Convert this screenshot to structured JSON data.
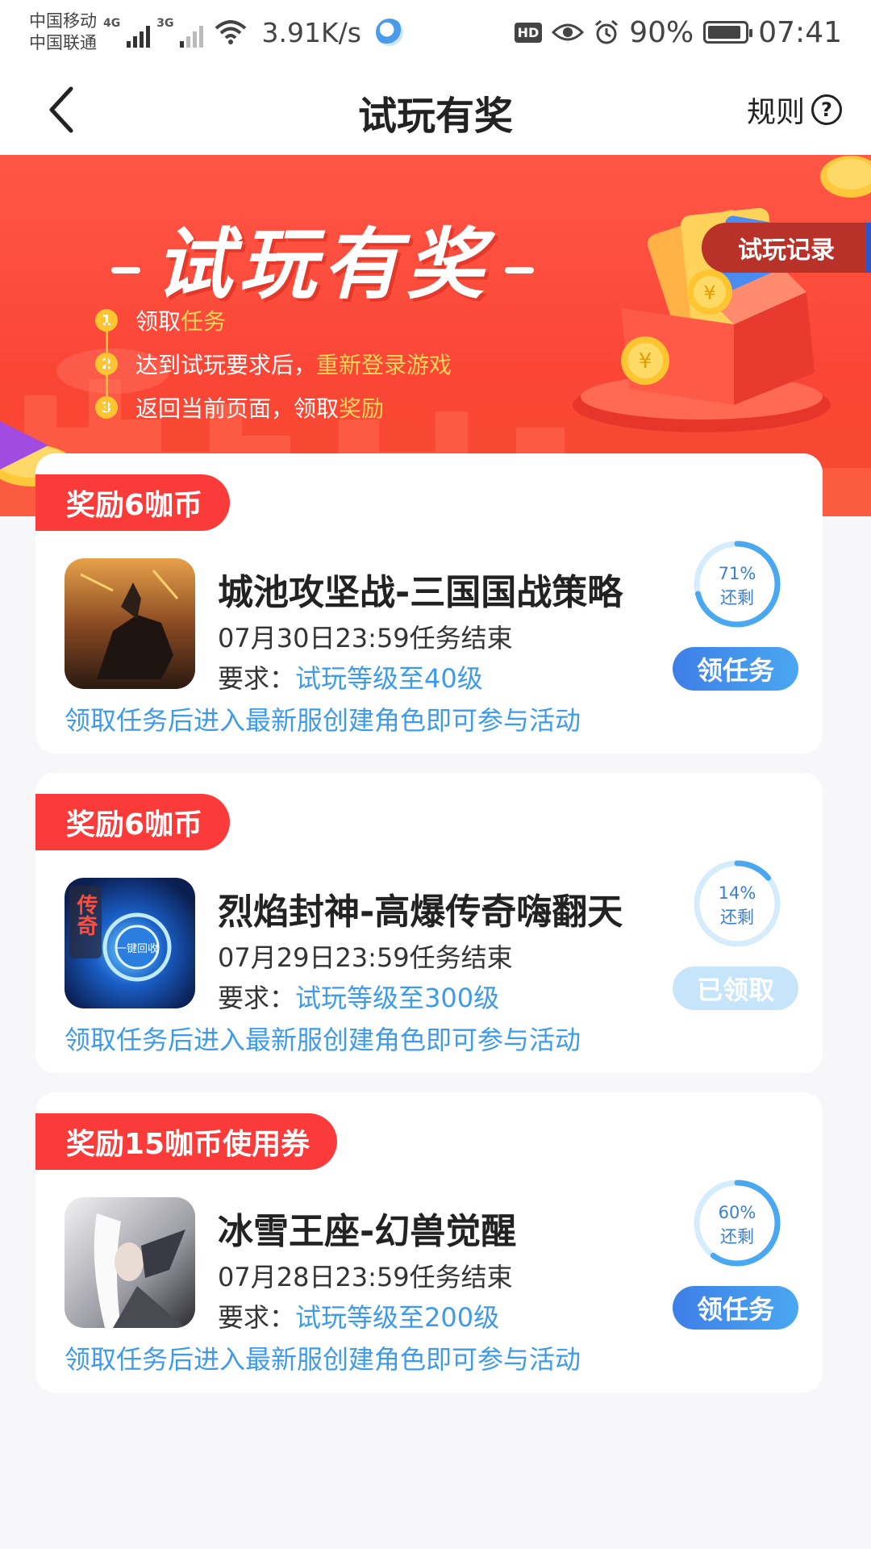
{
  "status_bar": {
    "carrier1": "中国移动",
    "carrier2": "中国联通",
    "net1": "4G",
    "net2": "3G",
    "speed": "3.91K/s",
    "hd": "HD",
    "battery": "90%",
    "battery_level": 0.9,
    "time": "07:41"
  },
  "nav": {
    "title": "试玩有奖",
    "rules_label": "规则",
    "rules_icon_glyph": "?"
  },
  "banner": {
    "title": "试玩有奖",
    "record_label": "试玩记录",
    "steps": [
      {
        "num": "1",
        "text": "领取",
        "highlight": "任务"
      },
      {
        "num": "2",
        "text": "达到试玩要求后，",
        "highlight": "重新登录游戏"
      },
      {
        "num": "3",
        "text": "返回当前页面，领取",
        "highlight": "奖励"
      }
    ]
  },
  "tasks": [
    {
      "reward": "奖励6咖币",
      "title": "城池攻坚战-三国国战策略",
      "deadline": "07月30日23:59任务结束",
      "req_label": "要求：",
      "req_value": "试玩等级至40级",
      "note": "领取任务后进入最新服创建角色即可参与活动",
      "percent_label": "71%",
      "remain_label": "还剩",
      "remaining": 0.71,
      "button": "领任务",
      "claimed": false
    },
    {
      "reward": "奖励6咖币",
      "title": "烈焰封神-高爆传奇嗨翻天",
      "deadline": "07月29日23:59任务结束",
      "req_label": "要求：",
      "req_value": "试玩等级至300级",
      "note": "领取任务后进入最新服创建角色即可参与活动",
      "percent_label": "14%",
      "remain_label": "还剩",
      "remaining": 0.14,
      "button": "已领取",
      "claimed": true,
      "icon_text1": "传奇",
      "icon_text2": "一键回收"
    },
    {
      "reward": "奖励15咖币使用券",
      "title": "冰雪王座-幻兽觉醒",
      "deadline": "07月28日23:59任务结束",
      "req_label": "要求：",
      "req_value": "试玩等级至200级",
      "note": "领取任务后进入最新服创建角色即可参与活动",
      "percent_label": "60%",
      "remain_label": "还剩",
      "remaining": 0.6,
      "button": "领任务",
      "claimed": false
    }
  ],
  "colors": {
    "brand_red": "#fb3a3a",
    "link_blue": "#3d9be9",
    "button_blue": "#3d7ee8",
    "claimed_blue": "#c6e5fb",
    "highlight_yellow": "#ffd45a"
  }
}
